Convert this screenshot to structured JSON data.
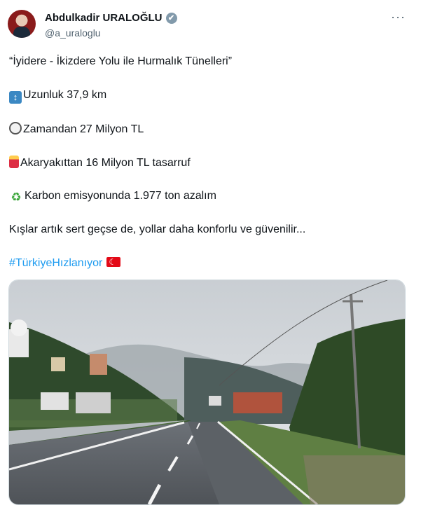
{
  "author": {
    "name": "Abdulkadir URALOĞLU",
    "handle": "@a_uraloglu",
    "verified_icon": "✔"
  },
  "more_icon": "···",
  "post": {
    "title_line": "“İyidere - İkizdere Yolu ile Hurmalık Tünelleri”",
    "lines": [
      {
        "icon": "up-down-arrow-icon",
        "text": "Uzunluk 37,9 km"
      },
      {
        "icon": "stopwatch-icon",
        "text": "Zamandan 27 Milyon TL"
      },
      {
        "icon": "fuel-pump-icon",
        "text": "Akaryakıttan 16 Milyon TL tasarruf"
      },
      {
        "icon": "recycle-icon",
        "text": "Karbon emisyonunda 1.977 ton azalım"
      }
    ],
    "closing": "Kışlar artık sert geçse de, yollar daha konforlu ve güvenilir...",
    "hashtag": "#TürkiyeHızlanıyor",
    "flag_icon": "turkey-flag-icon"
  },
  "colors": {
    "link": "#1d9bf0",
    "text": "#0f1419",
    "muted": "#536471",
    "verified": "#829aab"
  },
  "media": {
    "kind": "video-still",
    "scene": "mountain-road"
  }
}
